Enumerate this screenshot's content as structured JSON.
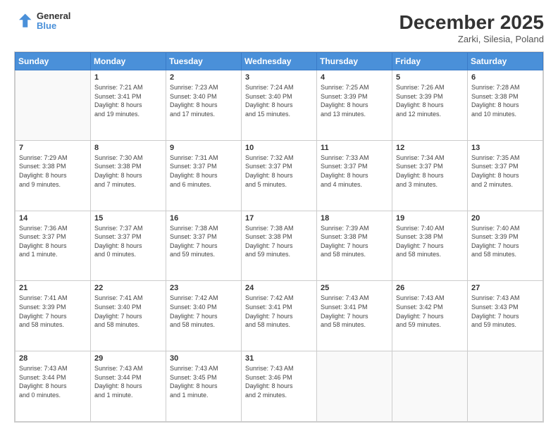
{
  "logo": {
    "line1": "General",
    "line2": "Blue"
  },
  "title": "December 2025",
  "subtitle": "Zarki, Silesia, Poland",
  "days_header": [
    "Sunday",
    "Monday",
    "Tuesday",
    "Wednesday",
    "Thursday",
    "Friday",
    "Saturday"
  ],
  "weeks": [
    [
      {
        "num": "",
        "info": ""
      },
      {
        "num": "1",
        "info": "Sunrise: 7:21 AM\nSunset: 3:41 PM\nDaylight: 8 hours\nand 19 minutes."
      },
      {
        "num": "2",
        "info": "Sunrise: 7:23 AM\nSunset: 3:40 PM\nDaylight: 8 hours\nand 17 minutes."
      },
      {
        "num": "3",
        "info": "Sunrise: 7:24 AM\nSunset: 3:40 PM\nDaylight: 8 hours\nand 15 minutes."
      },
      {
        "num": "4",
        "info": "Sunrise: 7:25 AM\nSunset: 3:39 PM\nDaylight: 8 hours\nand 13 minutes."
      },
      {
        "num": "5",
        "info": "Sunrise: 7:26 AM\nSunset: 3:39 PM\nDaylight: 8 hours\nand 12 minutes."
      },
      {
        "num": "6",
        "info": "Sunrise: 7:28 AM\nSunset: 3:38 PM\nDaylight: 8 hours\nand 10 minutes."
      }
    ],
    [
      {
        "num": "7",
        "info": "Sunrise: 7:29 AM\nSunset: 3:38 PM\nDaylight: 8 hours\nand 9 minutes."
      },
      {
        "num": "8",
        "info": "Sunrise: 7:30 AM\nSunset: 3:38 PM\nDaylight: 8 hours\nand 7 minutes."
      },
      {
        "num": "9",
        "info": "Sunrise: 7:31 AM\nSunset: 3:37 PM\nDaylight: 8 hours\nand 6 minutes."
      },
      {
        "num": "10",
        "info": "Sunrise: 7:32 AM\nSunset: 3:37 PM\nDaylight: 8 hours\nand 5 minutes."
      },
      {
        "num": "11",
        "info": "Sunrise: 7:33 AM\nSunset: 3:37 PM\nDaylight: 8 hours\nand 4 minutes."
      },
      {
        "num": "12",
        "info": "Sunrise: 7:34 AM\nSunset: 3:37 PM\nDaylight: 8 hours\nand 3 minutes."
      },
      {
        "num": "13",
        "info": "Sunrise: 7:35 AM\nSunset: 3:37 PM\nDaylight: 8 hours\nand 2 minutes."
      }
    ],
    [
      {
        "num": "14",
        "info": "Sunrise: 7:36 AM\nSunset: 3:37 PM\nDaylight: 8 hours\nand 1 minute."
      },
      {
        "num": "15",
        "info": "Sunrise: 7:37 AM\nSunset: 3:37 PM\nDaylight: 8 hours\nand 0 minutes."
      },
      {
        "num": "16",
        "info": "Sunrise: 7:38 AM\nSunset: 3:37 PM\nDaylight: 7 hours\nand 59 minutes."
      },
      {
        "num": "17",
        "info": "Sunrise: 7:38 AM\nSunset: 3:38 PM\nDaylight: 7 hours\nand 59 minutes."
      },
      {
        "num": "18",
        "info": "Sunrise: 7:39 AM\nSunset: 3:38 PM\nDaylight: 7 hours\nand 58 minutes."
      },
      {
        "num": "19",
        "info": "Sunrise: 7:40 AM\nSunset: 3:38 PM\nDaylight: 7 hours\nand 58 minutes."
      },
      {
        "num": "20",
        "info": "Sunrise: 7:40 AM\nSunset: 3:39 PM\nDaylight: 7 hours\nand 58 minutes."
      }
    ],
    [
      {
        "num": "21",
        "info": "Sunrise: 7:41 AM\nSunset: 3:39 PM\nDaylight: 7 hours\nand 58 minutes."
      },
      {
        "num": "22",
        "info": "Sunrise: 7:41 AM\nSunset: 3:40 PM\nDaylight: 7 hours\nand 58 minutes."
      },
      {
        "num": "23",
        "info": "Sunrise: 7:42 AM\nSunset: 3:40 PM\nDaylight: 7 hours\nand 58 minutes."
      },
      {
        "num": "24",
        "info": "Sunrise: 7:42 AM\nSunset: 3:41 PM\nDaylight: 7 hours\nand 58 minutes."
      },
      {
        "num": "25",
        "info": "Sunrise: 7:43 AM\nSunset: 3:41 PM\nDaylight: 7 hours\nand 58 minutes."
      },
      {
        "num": "26",
        "info": "Sunrise: 7:43 AM\nSunset: 3:42 PM\nDaylight: 7 hours\nand 59 minutes."
      },
      {
        "num": "27",
        "info": "Sunrise: 7:43 AM\nSunset: 3:43 PM\nDaylight: 7 hours\nand 59 minutes."
      }
    ],
    [
      {
        "num": "28",
        "info": "Sunrise: 7:43 AM\nSunset: 3:44 PM\nDaylight: 8 hours\nand 0 minutes."
      },
      {
        "num": "29",
        "info": "Sunrise: 7:43 AM\nSunset: 3:44 PM\nDaylight: 8 hours\nand 1 minute."
      },
      {
        "num": "30",
        "info": "Sunrise: 7:43 AM\nSunset: 3:45 PM\nDaylight: 8 hours\nand 1 minute."
      },
      {
        "num": "31",
        "info": "Sunrise: 7:43 AM\nSunset: 3:46 PM\nDaylight: 8 hours\nand 2 minutes."
      },
      {
        "num": "",
        "info": ""
      },
      {
        "num": "",
        "info": ""
      },
      {
        "num": "",
        "info": ""
      }
    ]
  ]
}
